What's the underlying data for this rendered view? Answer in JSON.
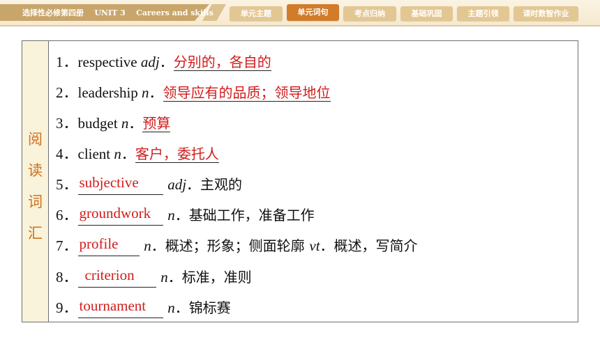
{
  "header": {
    "course_title": "选择性必修第四册    UNIT 3    Careers and skills",
    "tabs": [
      {
        "label": "单元主题",
        "active": false
      },
      {
        "label": "单元词句",
        "active": true
      },
      {
        "label": "考点归纳",
        "active": false
      },
      {
        "label": "基础巩固",
        "active": false
      },
      {
        "label": "主题引领",
        "active": false
      },
      {
        "label": "课时数智作业",
        "active": false
      }
    ]
  },
  "panel": {
    "side_label": [
      "阅",
      "读",
      "词",
      "汇"
    ],
    "items": [
      {
        "num": "1．",
        "word": "respective ",
        "pos": "adj",
        "sep": "．",
        "answer": "分别的，各自的"
      },
      {
        "num": "2．",
        "word": "leadership ",
        "pos": "n",
        "sep": "．",
        "answer": "领导应有的品质；领导地位"
      },
      {
        "num": "3．",
        "word": "budget ",
        "pos": "n",
        "sep": "．",
        "answer": "预算"
      },
      {
        "num": "4．",
        "word": "client ",
        "pos": "n",
        "sep": "．",
        "answer": "客户，委托人"
      },
      {
        "num": "5．",
        "answer": "subjective",
        "pos": "adj",
        "sep": "．",
        "meaning": "主观的"
      },
      {
        "num": "6．",
        "answer": "groundwork",
        "pos": "n",
        "sep": "．",
        "meaning": "基础工作，准备工作"
      },
      {
        "num": "7．",
        "answer": "profile",
        "pos": "n",
        "sep": "．",
        "meaning": "概述；形象；侧面轮廓",
        "pos2": "vt",
        "meaning2": "概述，写简介"
      },
      {
        "num": "8．",
        "answer": "criterion",
        "pos": "n",
        "sep": "．",
        "meaning": "标准，准则"
      },
      {
        "num": "9．",
        "answer": "tournament",
        "pos": "n",
        "sep": "．",
        "meaning": "锦标赛"
      }
    ]
  },
  "colors": {
    "accent": "#d17c2b",
    "answer_red": "#d11c1c",
    "tab_inactive": "#e3c793",
    "side_bg": "#f8f3da"
  }
}
